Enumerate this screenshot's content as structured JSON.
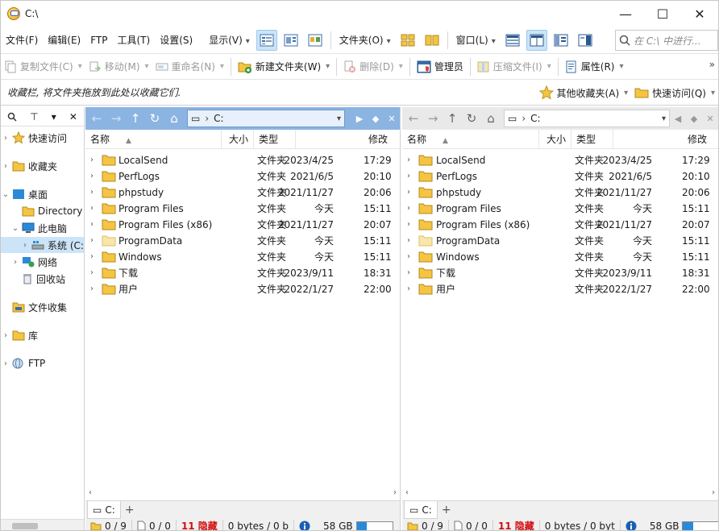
{
  "window": {
    "title": "C:\\",
    "min": "—",
    "max": "☐",
    "close": "✕"
  },
  "menu": {
    "file": "文件(F)",
    "edit": "编辑(E)",
    "ftp": "FTP",
    "tools": "工具(T)",
    "settings": "设置(S)",
    "display": "显示(V)",
    "folder": "文件夹(O)",
    "window": "窗口(L)"
  },
  "search": {
    "placeholder": "在 C:\\ 中进行..."
  },
  "actions": {
    "copy": "复制文件(C)",
    "move": "移动(M)",
    "rename": "重命名(N)",
    "new_folder": "新建文件夹(W)",
    "delete": "删除(D)",
    "admin": "管理员",
    "compress": "压缩文件(I)",
    "properties": "属性(R)"
  },
  "favbar": {
    "hint": "收藏栏, 将文件夹拖放到此处以收藏它们.",
    "other_favorites": "其他收藏夹(A)",
    "quick_access": "快速访问(Q)"
  },
  "tree": {
    "quick_access": "快速访问",
    "favorites": "收藏夹",
    "desktop": "桌面",
    "directory": "Directory",
    "this_pc": "此电脑",
    "system_drive": "系统 (C:",
    "network": "网络",
    "recycle": "回收站",
    "file_collection": "文件收集",
    "library": "库",
    "ftp": "FTP"
  },
  "columns": {
    "name": "名称",
    "size": "大小",
    "type": "类型",
    "modified": "修改"
  },
  "path": {
    "drive": "C:"
  },
  "files": [
    {
      "name": "LocalSend",
      "type": "文件夹",
      "date": "2023/4/25",
      "time": "17:29",
      "hidden": false
    },
    {
      "name": "PerfLogs",
      "type": "文件夹",
      "date": "2021/6/5",
      "time": "20:10",
      "hidden": false
    },
    {
      "name": "phpstudy",
      "type": "文件夹",
      "date": "2021/11/27",
      "time": "20:06",
      "hidden": false
    },
    {
      "name": "Program Files",
      "type": "文件夹",
      "date": "今天",
      "time": "15:11",
      "hidden": false
    },
    {
      "name": "Program Files (x86)",
      "type": "文件夹",
      "date": "2021/11/27",
      "time": "20:07",
      "hidden": false
    },
    {
      "name": "ProgramData",
      "type": "文件夹",
      "date": "今天",
      "time": "15:11",
      "hidden": true
    },
    {
      "name": "Windows",
      "type": "文件夹",
      "date": "今天",
      "time": "15:11",
      "hidden": false
    },
    {
      "name": "下载",
      "type": "文件夹",
      "date": "2023/9/11",
      "time": "18:31",
      "hidden": false
    },
    {
      "name": "用户",
      "type": "文件夹",
      "date": "2022/1/27",
      "time": "22:00",
      "hidden": false
    }
  ],
  "tab": {
    "label": "C:",
    "add": "+"
  },
  "status_left": {
    "folders": "0 / 9",
    "files": "0 / 0",
    "hidden": "11 隐藏",
    "bytes": "0 bytes / 0 b",
    "disk": "58 GB"
  },
  "status_right": {
    "folders": "0 / 9",
    "files": "0 / 0",
    "hidden": "11 隐藏",
    "bytes": "0 bytes / 0 byt",
    "disk": "58 GB"
  },
  "disk_used_fraction": 0.28,
  "colors": {
    "folder": "#f5c542",
    "active_pane": "#8cb4e2",
    "hidden_red": "#d01010",
    "disk_fill": "#2a8ad8"
  }
}
